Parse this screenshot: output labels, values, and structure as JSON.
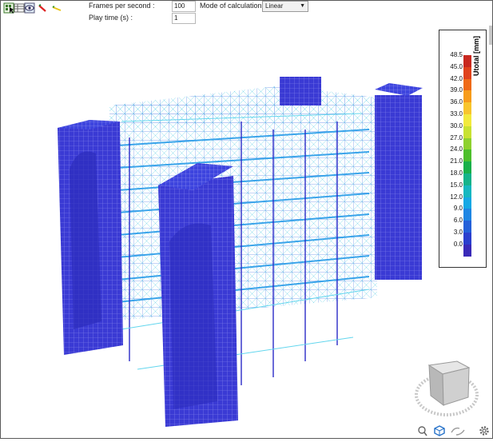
{
  "toolbar": {
    "frames_label": "Frames per second :",
    "frames_value": "100",
    "play_label": "Play time (s) :",
    "play_value": "1",
    "mode_label": "Mode of calculation :",
    "mode_value": "Linear"
  },
  "legend": {
    "title": "Utotal [mm]",
    "values": [
      "48.5",
      "45.0",
      "42.0",
      "39.0",
      "36.0",
      "33.0",
      "30.0",
      "27.0",
      "24.0",
      "21.0",
      "18.0",
      "15.0",
      "12.0",
      "9.0",
      "6.0",
      "3.0",
      "0.0"
    ],
    "colors": [
      "#c8281f",
      "#e0421c",
      "#ef6a18",
      "#f79c1a",
      "#f8c52c",
      "#f2ea3c",
      "#c8e232",
      "#8ed12f",
      "#4dbf2c",
      "#19b04a",
      "#14b38a",
      "#16b7c0",
      "#17a8e4",
      "#1e86e3",
      "#2460d9",
      "#2b3fce",
      "#3a2ab8"
    ]
  },
  "colors": {
    "structure_blue": "#3a3ad4",
    "mesh_line": "#8a8ae8",
    "member_cyan": "#5fd6e8"
  }
}
